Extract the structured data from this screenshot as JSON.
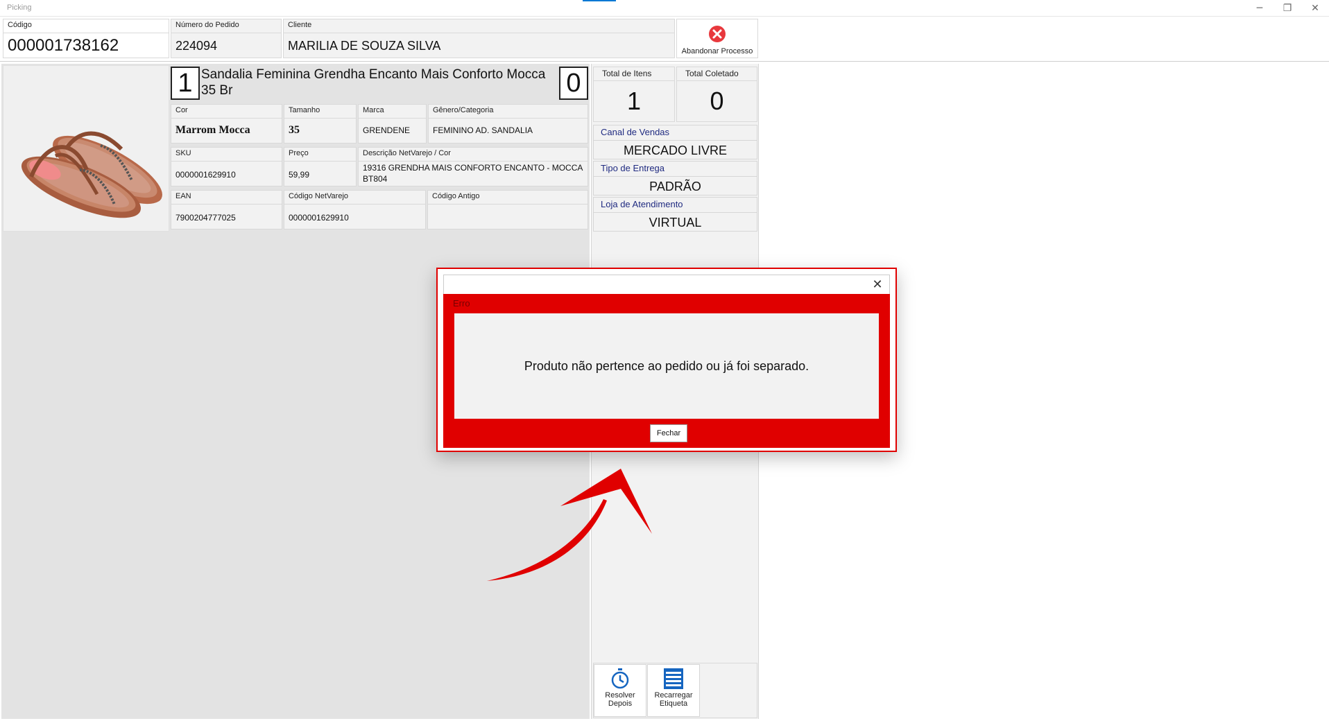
{
  "window": {
    "title": "Picking",
    "minimize_glyph": "─",
    "restore_glyph": "❐",
    "close_glyph": "✕",
    "accent_color": "#0078d4"
  },
  "header": {
    "codigo": {
      "label": "Código",
      "value": "000001738162"
    },
    "numero_pedido": {
      "label": "Número do Pedido",
      "value": "224094"
    },
    "cliente": {
      "label": "Cliente",
      "value": "MARILIA DE SOUZA SILVA"
    },
    "abandon_button": {
      "label": "Abandonar Processo",
      "icon": "close-circle-icon"
    }
  },
  "product": {
    "image_alt": "sandal",
    "quantity_left": "1",
    "title": "Sandalia Feminina Grendha Encanto Mais Conforto Mocca 35 Br",
    "quantity_right": "0",
    "cor": {
      "label": "Cor",
      "value": "Marrom Mocca"
    },
    "tamanho": {
      "label": "Tamanho",
      "value": "35"
    },
    "marca": {
      "label": "Marca",
      "value": "GRENDENE"
    },
    "genero": {
      "label": "Gênero/Categoria",
      "value": "FEMININO AD. SANDALIA"
    },
    "sku": {
      "label": "SKU",
      "value": "0000001629910"
    },
    "preco": {
      "label": "Preço",
      "value": "59,99"
    },
    "descricao": {
      "label": "Descrição NetVarejo / Cor",
      "value_line1": "19316 GRENDHA MAIS CONFORTO ENCANTO - MOCCA",
      "value_line2": "BT804"
    },
    "ean": {
      "label": "EAN",
      "value": "7900204777025"
    },
    "codigo_netvarejo": {
      "label": "Código NetVarejo",
      "value": "0000001629910"
    },
    "codigo_antigo": {
      "label": "Código Antigo",
      "value": ""
    }
  },
  "stats": {
    "total_itens": {
      "label": "Total de Itens",
      "value": "1"
    },
    "total_coletado": {
      "label": "Total Coletado",
      "value": "0"
    }
  },
  "info": {
    "canal": {
      "label": "Canal de Vendas",
      "value": "MERCADO LIVRE"
    },
    "entrega": {
      "label": "Tipo de Entrega",
      "value": "PADRÃO"
    },
    "loja": {
      "label": "Loja de Atendimento",
      "value": "VIRTUAL"
    }
  },
  "toolbar": {
    "resolver_line1": "Resolver",
    "resolver_line2": "Depois",
    "recarregar_line1": "Recarregar",
    "recarregar_line2": "Etiqueta"
  },
  "dialog": {
    "caption": "Erro",
    "message": "Produto não pertence ao pedido ou já foi separado.",
    "button_label": "Fechar",
    "close_glyph": "✕",
    "color": "#e00000"
  }
}
